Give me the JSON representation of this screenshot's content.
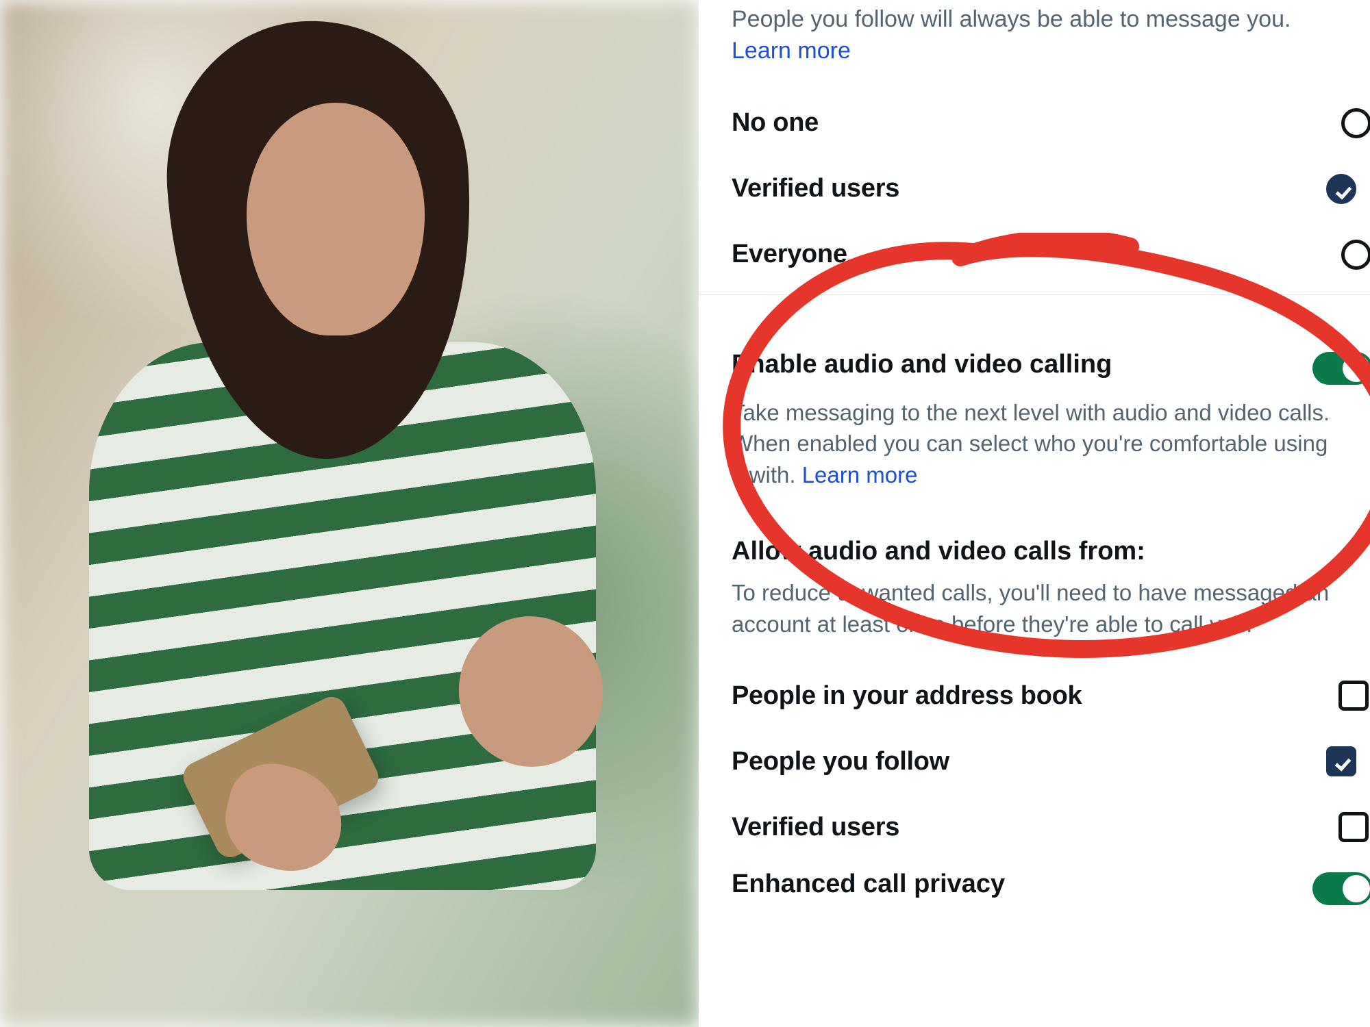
{
  "photo": {
    "alt": "Person looking at phone with confused expression"
  },
  "messaging": {
    "intro_text": "People you follow will always be able to message you.",
    "learn_more": "Learn more",
    "options": {
      "no_one": "No one",
      "verified": "Verified users",
      "everyone": "Everyone"
    },
    "selected": "verified"
  },
  "calling": {
    "title": "Enable audio and video calling",
    "body_prefix": "Take messaging to the next level with audio and video calls. When enabled you can select who you're comfortable using it with. ",
    "learn_more": "Learn more",
    "enabled": true
  },
  "allow_from": {
    "heading": "Allow audio and video calls from:",
    "note": "To reduce unwanted calls, you'll need to have messaged an account at least once before they're able to call you.",
    "options": {
      "address_book": {
        "label": "People in your address book",
        "checked": false
      },
      "follow": {
        "label": "People you follow",
        "checked": true
      },
      "verified": {
        "label": "Verified users",
        "checked": false
      }
    }
  },
  "enhanced": {
    "title": "Enhanced call privacy",
    "enabled": true
  },
  "annotation": {
    "color": "#e6352b"
  }
}
